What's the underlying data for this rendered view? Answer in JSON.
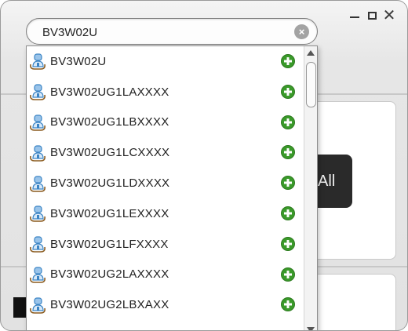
{
  "window": {
    "controls": [
      {
        "name": "minimize-icon"
      },
      {
        "name": "maximize-icon"
      },
      {
        "name": "close-icon"
      }
    ],
    "close_glyph": "✕"
  },
  "search": {
    "value": "BV3W02U",
    "clear_icon": "clear-search-icon"
  },
  "background": {
    "button_label": "All"
  },
  "dropdown": {
    "row_icon": "user-group-icon",
    "add_icon": "add-icon",
    "items": [
      {
        "label": "BV3W02U"
      },
      {
        "label": "BV3W02UG1LAXXXX"
      },
      {
        "label": "BV3W02UG1LBXXXX"
      },
      {
        "label": "BV3W02UG1LCXXXX"
      },
      {
        "label": "BV3W02UG1LDXXXX"
      },
      {
        "label": "BV3W02UG1LEXXXX"
      },
      {
        "label": "BV3W02UG1LFXXXX"
      },
      {
        "label": "BV3W02UG2LAXXXX"
      },
      {
        "label": "BV3W02UG2LBXAXX"
      }
    ]
  },
  "colors": {
    "add_green": "#3a9a2a",
    "icon_blue": "#3b84c4",
    "icon_brown": "#8a5a1e"
  }
}
